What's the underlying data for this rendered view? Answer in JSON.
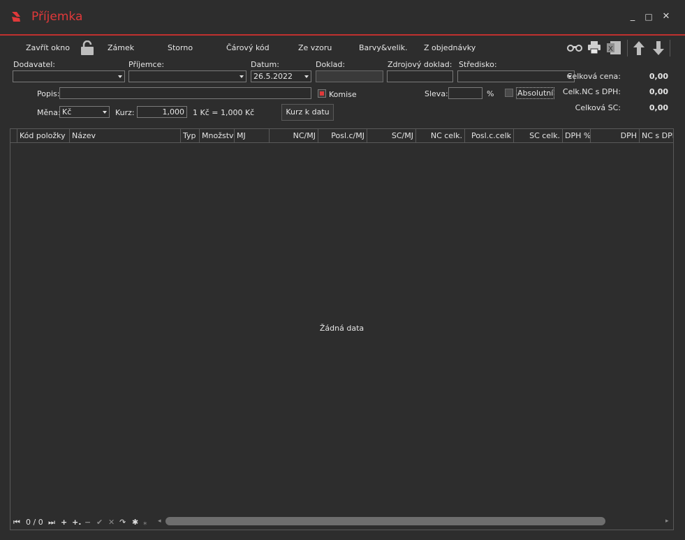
{
  "window": {
    "title": "Příjemka",
    "minimize": "_",
    "maximize": "□",
    "close": "✕"
  },
  "toolbar": {
    "close_window": "Zavřít okno",
    "lock": "Zámek",
    "storno": "Storno",
    "barcode": "Čárový kód",
    "from_template": "Ze vzoru",
    "colors_sizes": "Barvy&velik.",
    "from_order": "Z objednávky"
  },
  "form": {
    "supplier_label": "Dodavatel:",
    "supplier_value": "",
    "recipient_label": "Příjemce:",
    "recipient_value": "",
    "date_label": "Datum:",
    "date_value": "26.5.2022",
    "document_label": "Doklad:",
    "document_value": "",
    "source_doc_label": "Zdrojový doklad:",
    "source_doc_value": "",
    "center_label": "Středisko:",
    "center_value": "",
    "description_label": "Popis:",
    "description_value": "",
    "consignment_label": "Komise",
    "discount_label": "Sleva:",
    "discount_value": "",
    "percent": "%",
    "absolute_label": "Absolutní",
    "currency_label": "Měna:",
    "currency_value": "Kč",
    "rate_label": "Kurz:",
    "rate_value": "1,000",
    "rate_info": "1 Kč = 1,000 Kč",
    "rate_to_date_button": "Kurz k datu"
  },
  "summary": {
    "total_price_label": "Celková cena:",
    "total_price_value": "0,00",
    "total_nc_vat_label": "Celk.NC s DPH:",
    "total_nc_vat_value": "0,00",
    "total_sc_label": "Celková SC:",
    "total_sc_value": "0,00"
  },
  "grid": {
    "columns": [
      "Kód položky",
      "Název",
      "Typ",
      "Množství",
      "MJ",
      "NC/MJ",
      "Posl.c/MJ",
      "SC/MJ",
      "NC celk.",
      "Posl.c.celk",
      "SC celk.",
      "DPH %",
      "DPH",
      "NC s DPH"
    ],
    "empty_text": "Žádná data",
    "record_counter": "0 / 0"
  },
  "icons": [
    "pdf-app-icon",
    "lock-icon",
    "binoculars-icon",
    "printer-icon",
    "excel-icon",
    "arrow-up-icon",
    "arrow-down-icon"
  ],
  "colors": {
    "accent": "#e0393a",
    "background": "#2d2d2d",
    "border": "#7a7a7a"
  }
}
